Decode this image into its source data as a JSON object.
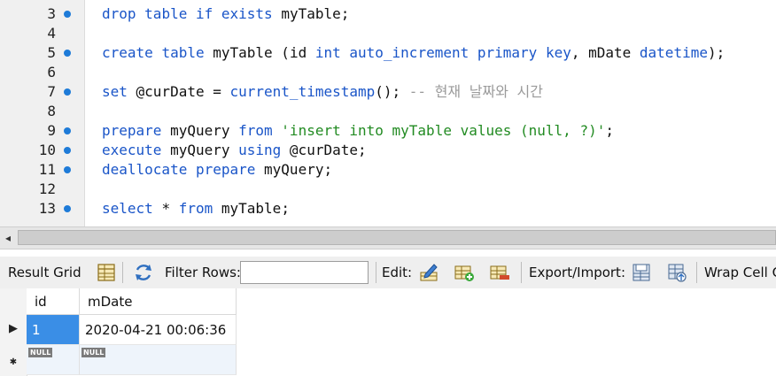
{
  "editor": {
    "lines": [
      {
        "number": "3",
        "marker": true,
        "tokens": [
          {
            "t": "drop ",
            "c": "kw"
          },
          {
            "t": "table ",
            "c": "kw"
          },
          {
            "t": "if ",
            "c": "kw"
          },
          {
            "t": "exists ",
            "c": "kw"
          },
          {
            "t": "myTable",
            "c": "id"
          },
          {
            "t": ";",
            "c": "op"
          }
        ]
      },
      {
        "number": "4",
        "marker": false,
        "tokens": []
      },
      {
        "number": "5",
        "marker": true,
        "tokens": [
          {
            "t": "create ",
            "c": "kw"
          },
          {
            "t": "table ",
            "c": "kw"
          },
          {
            "t": "myTable ",
            "c": "id"
          },
          {
            "t": "(",
            "c": "op"
          },
          {
            "t": "id ",
            "c": "id"
          },
          {
            "t": "int ",
            "c": "kw"
          },
          {
            "t": "auto_increment ",
            "c": "kw"
          },
          {
            "t": "primary ",
            "c": "kw"
          },
          {
            "t": "key",
            "c": "kw"
          },
          {
            "t": ", ",
            "c": "op"
          },
          {
            "t": "mDate ",
            "c": "id"
          },
          {
            "t": "datetime",
            "c": "kw"
          },
          {
            "t": ");",
            "c": "op"
          }
        ]
      },
      {
        "number": "6",
        "marker": false,
        "tokens": []
      },
      {
        "number": "7",
        "marker": true,
        "tokens": [
          {
            "t": "set ",
            "c": "kw"
          },
          {
            "t": "@curDate",
            "c": "var"
          },
          {
            "t": " = ",
            "c": "op"
          },
          {
            "t": "current_timestamp",
            "c": "fn"
          },
          {
            "t": "(); ",
            "c": "op"
          },
          {
            "t": "-- 현재 날짜와 시간",
            "c": "cmt"
          }
        ]
      },
      {
        "number": "8",
        "marker": false,
        "tokens": []
      },
      {
        "number": "9",
        "marker": true,
        "tokens": [
          {
            "t": "prepare ",
            "c": "kw"
          },
          {
            "t": "myQuery ",
            "c": "id"
          },
          {
            "t": "from ",
            "c": "kw"
          },
          {
            "t": "'insert into myTable values (null, ?)'",
            "c": "str"
          },
          {
            "t": ";",
            "c": "op"
          }
        ]
      },
      {
        "number": "10",
        "marker": true,
        "tokens": [
          {
            "t": "execute ",
            "c": "kw"
          },
          {
            "t": "myQuery ",
            "c": "id"
          },
          {
            "t": "using ",
            "c": "kw"
          },
          {
            "t": "@curDate",
            "c": "var"
          },
          {
            "t": ";",
            "c": "op"
          }
        ]
      },
      {
        "number": "11",
        "marker": true,
        "tokens": [
          {
            "t": "deallocate ",
            "c": "kw"
          },
          {
            "t": "prepare ",
            "c": "kw"
          },
          {
            "t": "myQuery",
            "c": "id"
          },
          {
            "t": ";",
            "c": "op"
          }
        ]
      },
      {
        "number": "12",
        "marker": false,
        "tokens": []
      },
      {
        "number": "13",
        "marker": true,
        "tokens": [
          {
            "t": "select ",
            "c": "kw"
          },
          {
            "t": "* ",
            "c": "op"
          },
          {
            "t": "from ",
            "c": "kw"
          },
          {
            "t": "myTable",
            "c": "id"
          },
          {
            "t": ";",
            "c": "op"
          }
        ]
      }
    ]
  },
  "toolbar": {
    "result_grid_label": "Result Grid",
    "filter_rows_label": "Filter Rows:",
    "filter_value": "",
    "edit_label": "Edit:",
    "export_import_label": "Export/Import:",
    "wrap_label": "Wrap Cell C"
  },
  "grid": {
    "columns": [
      "id",
      "mDate"
    ],
    "rows": [
      {
        "id": "1",
        "mDate": "2020-04-21 00:06:36"
      }
    ],
    "null_label": "NULL",
    "row_indicator": "▶",
    "new_row_indicator": "✱"
  },
  "icons": {
    "scroll_left": "scroll-left-arrow-icon",
    "result_grid": "grid-icon",
    "filter": "filter-icon",
    "edit": "edit-pencil-icon",
    "add_row": "add-row-icon",
    "delete_row": "delete-row-icon",
    "export": "export-icon",
    "import": "import-icon"
  },
  "colors": {
    "keyword": "#1a55c8",
    "string": "#228b22",
    "comment": "#9a9a9a",
    "marker": "#1e7bd8",
    "selection": "#3a8ee6"
  }
}
